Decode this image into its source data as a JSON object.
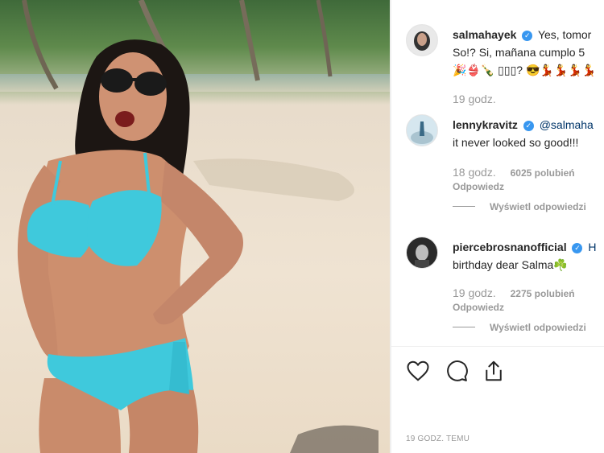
{
  "post": {
    "photo_alt": "Woman in turquoise bikini posing on a sandy beach",
    "time_ago": "19 GODZ. TEMU"
  },
  "caption": {
    "username": "salmahayek",
    "text_line1": "Yes, tomor",
    "text_line2": "So!? Si, mañana cumplo 5",
    "emoji_line": "🎉👙🍾 ▯▯▯? 😎💃💃💃💃",
    "time": "19 godz."
  },
  "comments": [
    {
      "username": "lennykravitz",
      "mention": "@salmaha",
      "text_line2": "it never looked so good!!!",
      "time": "18 godz.",
      "likes": "6025 polubień",
      "reply_label": "Odpowiedz",
      "view_replies": "Wyświetl odpowiedzi"
    },
    {
      "username": "piercebrosnanofficial",
      "mention": "H",
      "text_line2": "birthday dear Salma☘️",
      "time": "19 godz.",
      "likes": "2275 polubień",
      "reply_label": "Odpowiedz",
      "view_replies": "Wyświetl odpowiedzi"
    }
  ],
  "colors": {
    "verified": "#3897f0",
    "muted": "#999999",
    "text": "#262626",
    "bikini": "#3fc9dc"
  },
  "icons": [
    "heart-icon",
    "comment-icon",
    "share-icon",
    "verified-badge-icon"
  ]
}
